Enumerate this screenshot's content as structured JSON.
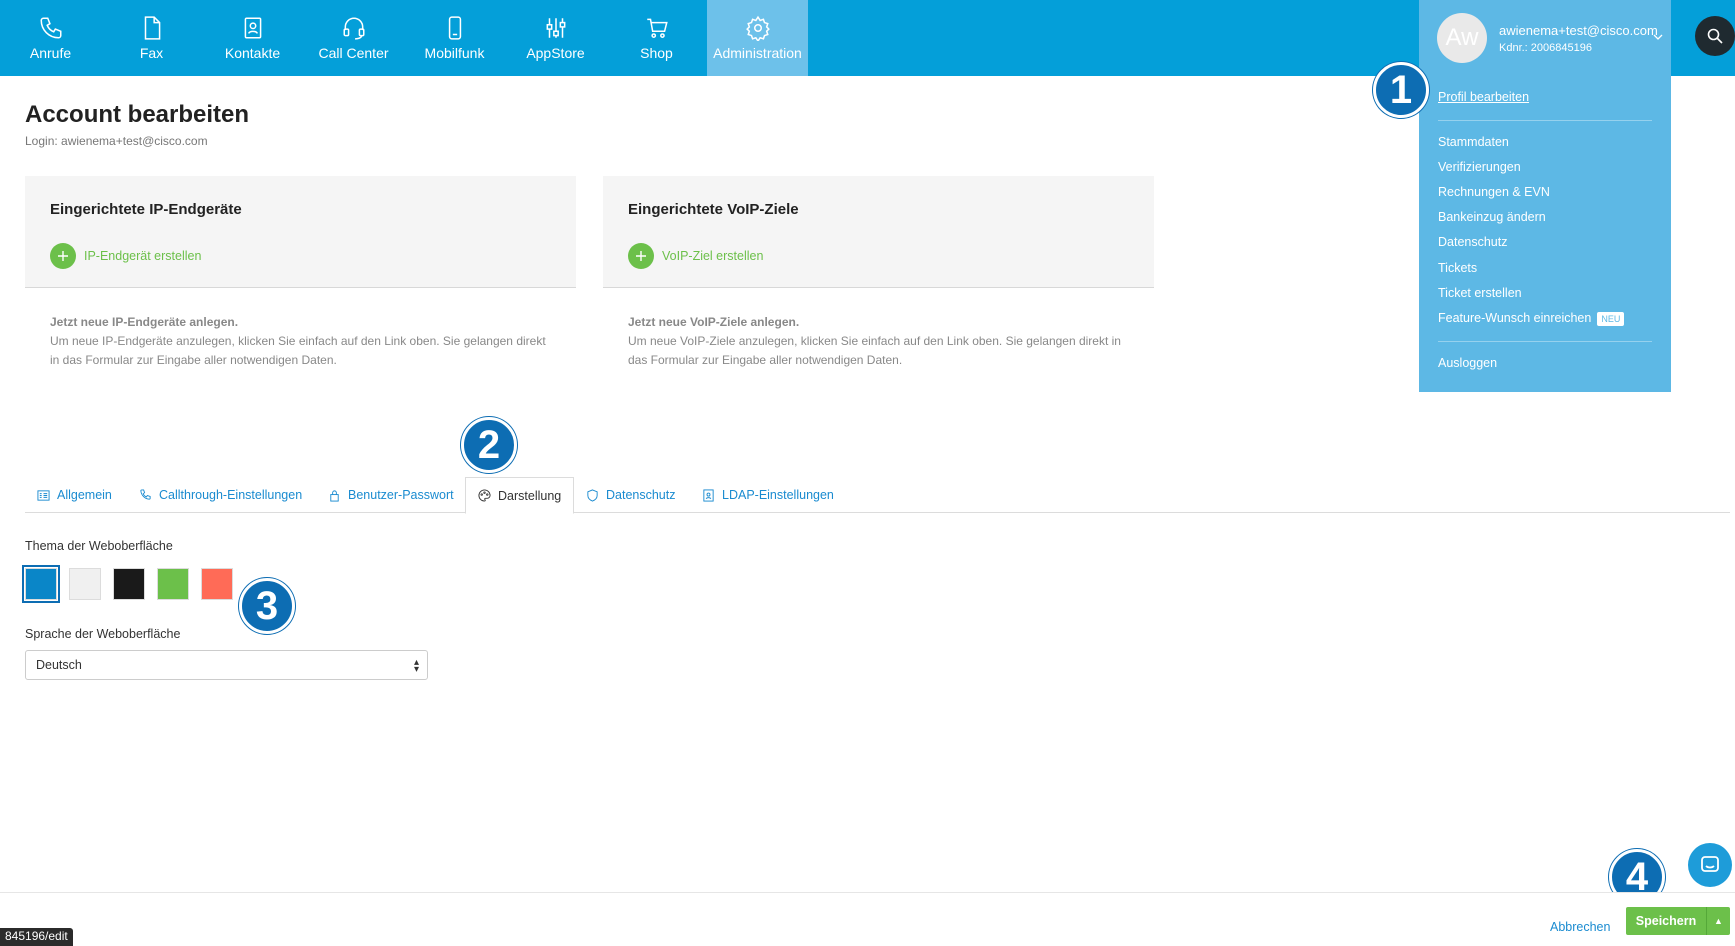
{
  "nav": {
    "items": [
      {
        "label": "Anrufe",
        "icon": "phone-icon"
      },
      {
        "label": "Fax",
        "icon": "fax-document-icon"
      },
      {
        "label": "Kontakte",
        "icon": "contacts-icon"
      },
      {
        "label": "Call Center",
        "icon": "headset-icon"
      },
      {
        "label": "Mobilfunk",
        "icon": "mobile-phone-icon"
      },
      {
        "label": "AppStore",
        "icon": "appstore-icon"
      },
      {
        "label": "Shop",
        "icon": "cart-icon"
      },
      {
        "label": "Administration",
        "icon": "gear-icon",
        "active": true
      }
    ]
  },
  "user": {
    "initials": "Aw",
    "email": "awienema+test@cisco.com",
    "kdnr": "Kdnr.: 2006845196"
  },
  "dropdown": {
    "profile": "Profil bearbeiten",
    "items": [
      "Stammdaten",
      "Verifizierungen",
      "Rechnungen & EVN",
      "Bankeinzug ändern",
      "Datenschutz",
      "Tickets",
      "Ticket erstellen"
    ],
    "feature": "Feature-Wunsch einreichen",
    "feature_badge": "NEU",
    "logout": "Ausloggen"
  },
  "markers": [
    "1",
    "2",
    "3",
    "4"
  ],
  "page": {
    "title": "Account bearbeiten",
    "login": "Login: awienema+test@cisco.com"
  },
  "cards": [
    {
      "title": "Eingerichtete IP-Endgeräte",
      "action": "IP-Endgerät erstellen",
      "desc_title": "Jetzt neue IP-Endgeräte anlegen.",
      "desc_body": "Um neue IP-Endgeräte anzulegen, klicken Sie einfach auf den Link oben. Sie gelangen direkt in das Formular zur Eingabe aller notwendigen Daten."
    },
    {
      "title": "Eingerichtete VoIP-Ziele",
      "action": "VoIP-Ziel erstellen",
      "desc_title": "Jetzt neue VoIP-Ziele anlegen.",
      "desc_body": "Um neue VoIP-Ziele anzulegen, klicken Sie einfach auf den Link oben. Sie gelangen direkt in das Formular zur Eingabe aller notwendigen Daten."
    }
  ],
  "tabs": [
    {
      "label": "Allgemein",
      "icon": "list-icon"
    },
    {
      "label": "Callthrough-Einstellungen",
      "icon": "phone-icon"
    },
    {
      "label": "Benutzer-Passwort",
      "icon": "lock-icon"
    },
    {
      "label": "Darstellung",
      "icon": "palette-icon",
      "active": true
    },
    {
      "label": "Datenschutz",
      "icon": "shield-icon"
    },
    {
      "label": "LDAP-Einstellungen",
      "icon": "address-book-icon"
    }
  ],
  "theme": {
    "label": "Thema der Weboberfläche",
    "swatches": [
      "#0a86c8",
      "#f0f0f0",
      "#1a1a1a",
      "#6cc04a",
      "#ff6b57"
    ],
    "selected": 0
  },
  "language": {
    "label": "Sprache der Weboberfläche",
    "value": "Deutsch"
  },
  "footer": {
    "cancel": "Abbrechen",
    "save": "Speichern"
  },
  "status_url": "845196/edit",
  "colors": {
    "brand": "#049fd9",
    "dropdown": "#5db8e5",
    "success": "#6cc04a",
    "link": "#1a8bd0",
    "marker": "#0d6db3"
  }
}
